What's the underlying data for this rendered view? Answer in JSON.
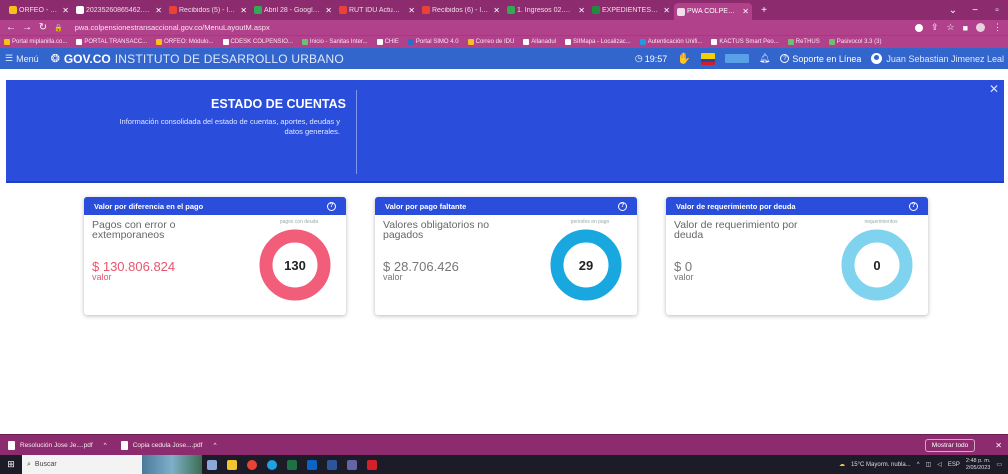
{
  "browser": {
    "tabs": [
      {
        "label": "ORFEO - Sistema de",
        "color": "#f5c21b"
      },
      {
        "label": "20235260865462.pdf",
        "color": "#ffffff"
      },
      {
        "label": "Recibidos (5) - laura.r",
        "color": "#ea4335"
      },
      {
        "label": "Abril 28 - Google Dri",
        "color": "#34a853"
      },
      {
        "label": "RUT IDU Actualizado",
        "color": "#ea4335"
      },
      {
        "label": "Recibidos (6) - laura.r",
        "color": "#ea4335"
      },
      {
        "label": "1. Ingresos 02.05.2023",
        "color": "#34a853"
      },
      {
        "label": "EXPEDIENTES LABOR",
        "color": "#1e8e3e"
      },
      {
        "label": "PWA COLPENSIONES",
        "color": "#f0e0ea"
      }
    ],
    "url": "pwa.colpensionestransaccional.gov.co/MenuLayoutM.aspx",
    "bookmarks": [
      "Portal miplanilla.co...",
      "PORTAL TRANSACC...",
      "ORFEO: Módulo...",
      "CDESK COLPENSIO...",
      "Inicio - Sanitas Inter...",
      "CHIE",
      "Portal SIMO 4.0",
      "Correo de IDU",
      "Allanadul",
      "SIIMapa - Localizac...",
      "Autenticación Unifi...",
      "KACTUS Smart Peo...",
      "ReTHUS",
      "Pasivocol 3.3 (3)"
    ]
  },
  "header": {
    "menu": "Menú",
    "gov": "GOV.CO",
    "institution": "INSTITUTO DE DESARROLLO URBANO",
    "time": "19:57",
    "support": "Soporte en Línea",
    "user": "Juan Sebastian Jimenez Leal"
  },
  "banner": {
    "title": "ESTADO DE CUENTAS",
    "description": "Información consolidada del estado de cuentas, aportes, deudas y\ndatos generales."
  },
  "cards": [
    {
      "title": "Valor por diferencia en el pago",
      "desc": "Pagos con error o extemporaneos",
      "value": "$ 130.806.824",
      "value_label": "valor",
      "tiny": "pagos con deuda",
      "count": "130",
      "ring_color": "#f25d7a",
      "value_color": "#e8556e"
    },
    {
      "title": "Valor por pago faltante",
      "desc": "Valores obligatorios no pagados",
      "value": "$ 28.706.426",
      "value_label": "valor",
      "tiny": "periodos en pago",
      "count": "29",
      "ring_color": "#19a7e0",
      "value_color": "#777777"
    },
    {
      "title": "Valor de requerimiento por deuda",
      "desc": "Valor de requerimiento por deuda",
      "value": "$ 0",
      "value_label": "valor",
      "tiny": "requerimientos",
      "count": "0",
      "ring_color": "#7fd3ee",
      "value_color": "#777777"
    }
  ],
  "downloads": {
    "files": [
      "Resolución Jose Je....pdf",
      "Copia cedula Jose....pdf"
    ],
    "show_all": "Mostrar todo"
  },
  "taskbar": {
    "search": "Buscar",
    "weather": "15°C Mayorm. nubla...",
    "lang": "ESP",
    "time": "2:48 p. m.",
    "date": "2/05/2023"
  }
}
